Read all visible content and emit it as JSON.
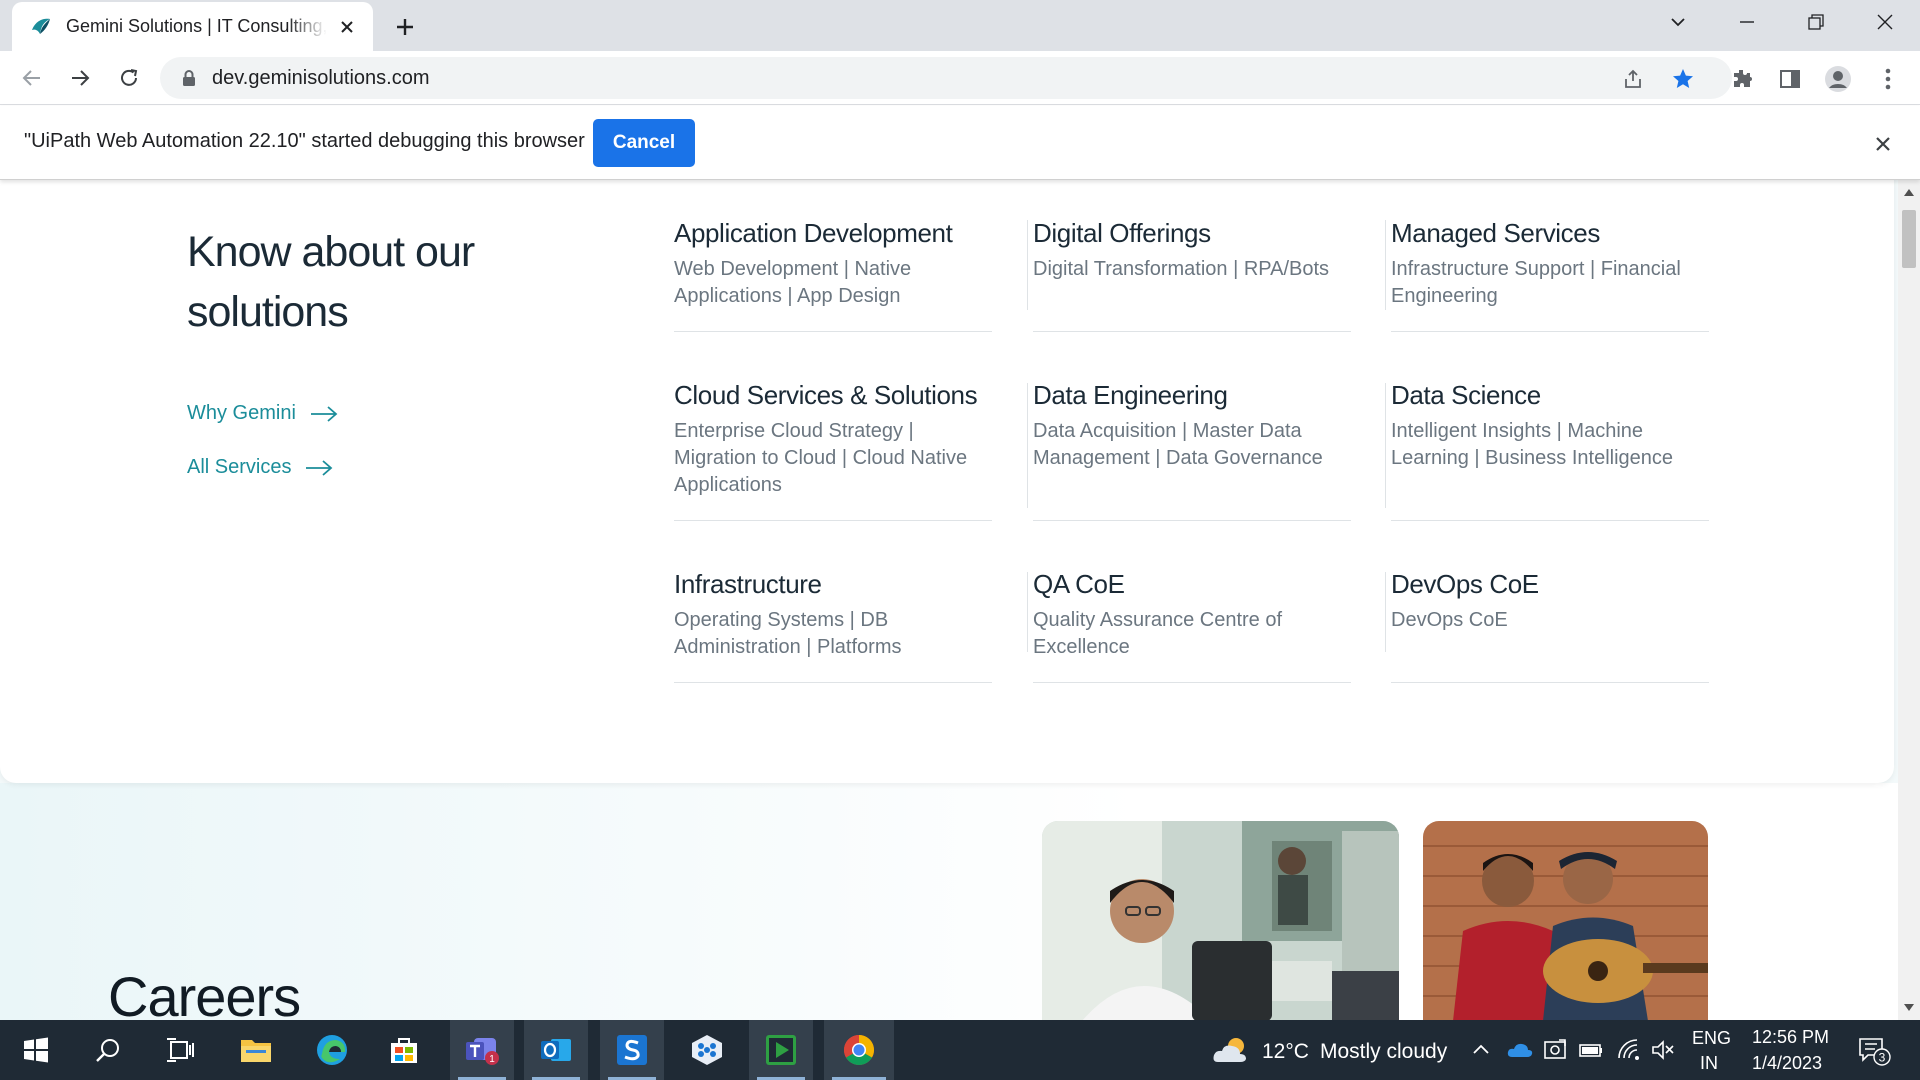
{
  "browser": {
    "tab_title": "Gemini Solutions | IT Consulting, Digital...",
    "url": "dev.geminisolutions.com"
  },
  "infobar": {
    "message": "\"UiPath Web Automation 22.10\" started debugging this browser",
    "cancel_label": "Cancel"
  },
  "page": {
    "heading": "Know about our solutions",
    "links": [
      {
        "label": "Why Gemini"
      },
      {
        "label": "All Services"
      }
    ],
    "services": [
      {
        "title": "Application Development",
        "desc": "Web Development | Native Applications | App Design"
      },
      {
        "title": "Digital Offerings",
        "desc": "Digital Transformation | RPA/Bots"
      },
      {
        "title": "Managed Services",
        "desc": "Infrastructure Support | Financial Engineering"
      },
      {
        "title": "Cloud Services & Solutions",
        "desc": "Enterprise Cloud Strategy | Migration to Cloud | Cloud Native Applications"
      },
      {
        "title": "Data Engineering",
        "desc": "Data Acquisition | Master Data Management | Data Governance"
      },
      {
        "title": "Data Science",
        "desc": "Intelligent Insights | Machine Learning | Business Intelligence"
      },
      {
        "title": "Infrastructure",
        "desc": "Operating Systems | DB Administration | Platforms"
      },
      {
        "title": "QA CoE",
        "desc": "Quality Assurance Centre of Excellence"
      },
      {
        "title": "DevOps CoE",
        "desc": "DevOps CoE"
      }
    ],
    "careers_title": "Careers"
  },
  "taskbar": {
    "apps": [
      "start-icon",
      "search-icon",
      "task-view-icon",
      "file-explorer-icon",
      "edge-icon",
      "store-icon",
      "teams-icon",
      "outlook-icon",
      "uipath-studio-icon",
      "uipath-assistant-icon",
      "uipath-player-icon",
      "chrome-icon"
    ],
    "teams_badge": "1",
    "temperature": "12°C",
    "weather": "Mostly cloudy",
    "lang_top": "ENG",
    "lang_bottom": "IN",
    "time": "12:56 PM",
    "date": "1/4/2023",
    "notifications": "3"
  },
  "colors": {
    "accent": "#1a73e8",
    "link": "#1b8d9a",
    "heading": "#1b2a36",
    "taskbar": "#1f2a35"
  }
}
